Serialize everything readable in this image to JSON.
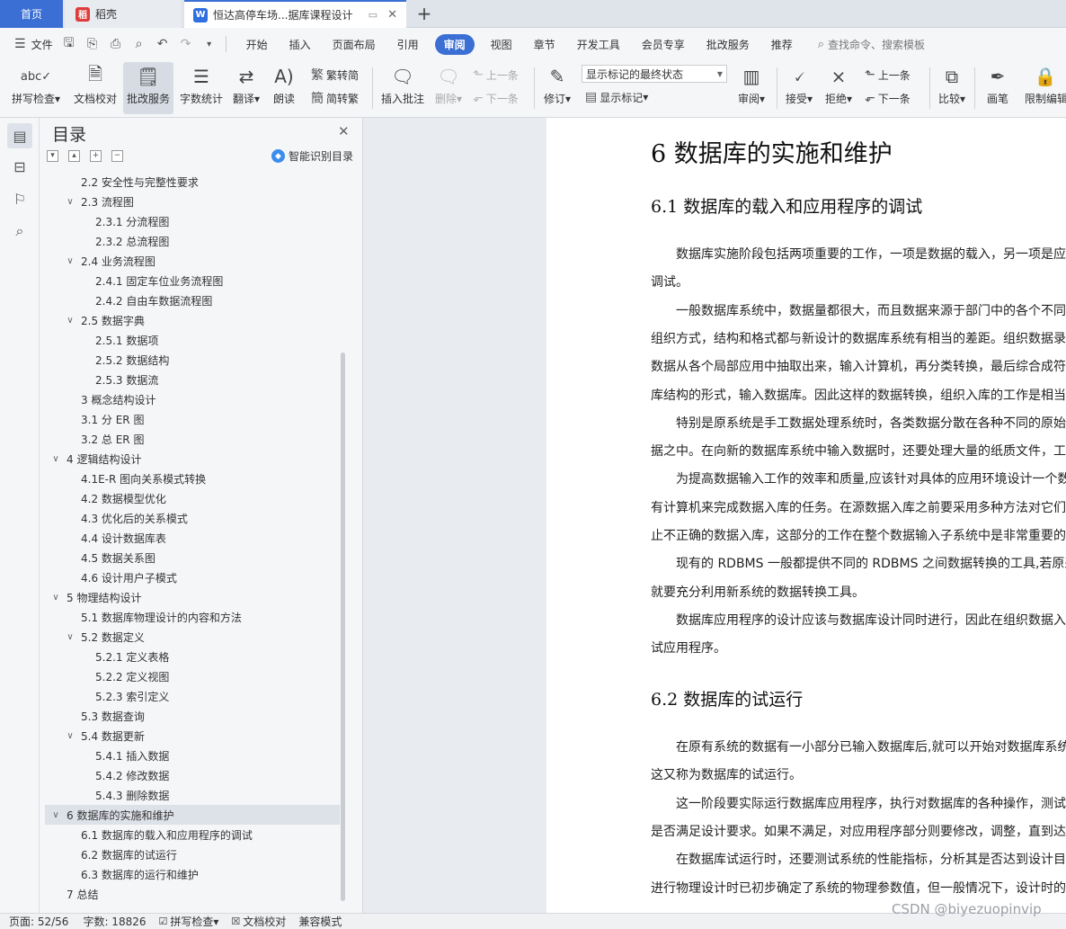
{
  "tabs": {
    "home": "首页",
    "daoke": "稻壳",
    "doc": "恒达高停车场...据库课程设计"
  },
  "menu": {
    "file": "文件",
    "items": [
      "开始",
      "插入",
      "页面布局",
      "引用",
      "审阅",
      "视图",
      "章节",
      "开发工具",
      "会员专享",
      "批改服务",
      "推荐"
    ],
    "active": "审阅",
    "search_placeholder": "查找命令、搜索模板"
  },
  "ribbon": {
    "spellcheck": "拼写检查",
    "doc_proof": "文档校对",
    "review_service": "批改服务",
    "word_count": "字数统计",
    "translate": "翻译",
    "read_aloud": "朗读",
    "trad_to_simp": "繁转简",
    "simp_to_trad": "简转繁",
    "insert_comment": "插入批注",
    "delete": "删除",
    "prev": "上一条",
    "next": "下一条",
    "track_changes": "修订",
    "markup_state": "显示标记的最终状态",
    "show_markup": "显示标记",
    "review": "审阅",
    "accept": "接受",
    "reject": "拒绝",
    "prev2": "上一条",
    "next2": "下一条",
    "compare": "比较",
    "pen": "画笔",
    "restrict": "限制编辑"
  },
  "nav": {
    "title": "目录",
    "smart_toc": "智能识别目录",
    "toc": [
      {
        "text": "2.2 安全性与完整性要求",
        "level": 2,
        "tog": ""
      },
      {
        "text": "2.3 流程图",
        "level": 2,
        "tog": "v"
      },
      {
        "text": "2.3.1 分流程图",
        "level": 3,
        "tog": ""
      },
      {
        "text": "2.3.2 总流程图",
        "level": 3,
        "tog": ""
      },
      {
        "text": "2.4 业务流程图",
        "level": 2,
        "tog": "v"
      },
      {
        "text": "2.4.1 固定车位业务流程图",
        "level": 3,
        "tog": ""
      },
      {
        "text": "2.4.2 自由车数据流程图",
        "level": 3,
        "tog": ""
      },
      {
        "text": "2.5 数据字典",
        "level": 2,
        "tog": "v"
      },
      {
        "text": "2.5.1 数据项",
        "level": 3,
        "tog": ""
      },
      {
        "text": "2.5.2 数据结构",
        "level": 3,
        "tog": ""
      },
      {
        "text": "2.5.3 数据流",
        "level": 3,
        "tog": ""
      },
      {
        "text": "3 概念结构设计",
        "level": 2,
        "tog": ""
      },
      {
        "text": "3.1 分 ER 图",
        "level": 2,
        "tog": ""
      },
      {
        "text": "3.2 总 ER 图",
        "level": 2,
        "tog": ""
      },
      {
        "text": "4 逻辑结构设计",
        "level": 1,
        "tog": "v"
      },
      {
        "text": "4.1E-R 图向关系模式转换",
        "level": 2,
        "tog": ""
      },
      {
        "text": "4.2 数据模型优化",
        "level": 2,
        "tog": ""
      },
      {
        "text": "4.3 优化后的关系模式",
        "level": 2,
        "tog": ""
      },
      {
        "text": "4.4 设计数据库表",
        "level": 2,
        "tog": ""
      },
      {
        "text": "4.5 数据关系图",
        "level": 2,
        "tog": ""
      },
      {
        "text": "4.6 设计用户子模式",
        "level": 2,
        "tog": ""
      },
      {
        "text": "5 物理结构设计",
        "level": 1,
        "tog": "v"
      },
      {
        "text": "5.1 数据库物理设计的内容和方法",
        "level": 2,
        "tog": ""
      },
      {
        "text": "5.2 数据定义",
        "level": 2,
        "tog": "v"
      },
      {
        "text": "5.2.1 定义表格",
        "level": 3,
        "tog": ""
      },
      {
        "text": "5.2.2 定义视图",
        "level": 3,
        "tog": ""
      },
      {
        "text": "5.2.3 索引定义",
        "level": 3,
        "tog": ""
      },
      {
        "text": "5.3 数据查询",
        "level": 2,
        "tog": ""
      },
      {
        "text": "5.4 数据更新",
        "level": 2,
        "tog": "v"
      },
      {
        "text": "5.4.1 插入数据",
        "level": 3,
        "tog": ""
      },
      {
        "text": "5.4.2 修改数据",
        "level": 3,
        "tog": ""
      },
      {
        "text": "5.4.3 删除数据",
        "level": 3,
        "tog": ""
      },
      {
        "text": "6 数据库的实施和维护",
        "level": 1,
        "tog": "v",
        "active": true
      },
      {
        "text": "6.1 数据库的载入和应用程序的调试",
        "level": 2,
        "tog": ""
      },
      {
        "text": "6.2 数据库的试运行",
        "level": 2,
        "tog": ""
      },
      {
        "text": "6.3 数据库的运行和维护",
        "level": 2,
        "tog": ""
      },
      {
        "text": "7 总结",
        "level": 1,
        "tog": ""
      }
    ]
  },
  "doc": {
    "h1": "6 数据库的实施和维护",
    "h2a": "6.1 数据库的载入和应用程序的调试",
    "h2b": "6.2 数据库的试运行",
    "lines_a": [
      {
        "t": "数据库实施阶段包括两项重要的工作，一项是数据的载入，另一项是应",
        "ind": true
      },
      {
        "t": "调试。",
        "ind": false
      },
      {
        "t": "一般数据库系统中，数据量都很大，而且数据来源于部门中的各个不同",
        "ind": true
      },
      {
        "t": "组织方式，结构和格式都与新设计的数据库系统有相当的差距。组织数据录",
        "ind": false
      },
      {
        "t": "数据从各个局部应用中抽取出来，输入计算机，再分类转换，最后综合成符",
        "ind": false
      },
      {
        "t": "库结构的形式，输入数据库。因此这样的数据转换，组织入库的工作是相当",
        "ind": false
      },
      {
        "t": "特别是原系统是手工数据处理系统时，各类数据分散在各种不同的原始",
        "ind": true
      },
      {
        "t": "据之中。在向新的数据库系统中输入数据时，还要处理大量的纸质文件，工",
        "ind": false
      },
      {
        "t": "为提高数据输入工作的效率和质量,应该针对具体的应用环境设计一个数",
        "ind": true
      },
      {
        "t": "有计算机来完成数据入库的任务。在源数据入库之前要采用多种方法对它们",
        "ind": false
      },
      {
        "t": "止不正确的数据入库，这部分的工作在整个数据输入子系统中是非常重要的",
        "ind": false
      },
      {
        "t": "现有的 RDBMS 一般都提供不同的 RDBMS 之间数据转换的工具,若原来",
        "ind": true
      },
      {
        "t": "就要充分利用新系统的数据转换工具。",
        "ind": false
      },
      {
        "t": "数据库应用程序的设计应该与数据库设计同时进行，因此在组织数据入",
        "ind": true
      },
      {
        "t": "试应用程序。",
        "ind": false
      }
    ],
    "lines_b": [
      {
        "t": "在原有系统的数据有一小部分已输入数据库后,就可以开始对数据库系统",
        "ind": true
      },
      {
        "t": "这又称为数据库的试运行。",
        "ind": false
      },
      {
        "t": "这一阶段要实际运行数据库应用程序，执行对数据库的各种操作，测试",
        "ind": true
      },
      {
        "t": "是否满足设计要求。如果不满足，对应用程序部分则要修改，调整，直到达",
        "ind": false
      },
      {
        "t": "在数据库试运行时，还要测试系统的性能指标，分析其是否达到设计目",
        "ind": true
      },
      {
        "t": "进行物理设计时已初步确定了系统的物理参数值，但一般情况下，设计时的",
        "ind": false
      }
    ]
  },
  "status": {
    "page": "页面: 52/56",
    "words": "字数: 18826",
    "spellcheck": "拼写检查",
    "doc_proof": "文档校对",
    "compat": "兼容模式"
  },
  "watermark": "CSDN @biyezuopinvip",
  "colors": {
    "accent": "#3b6fd4",
    "tab_bar": "#dfe3ea",
    "panel": "#f5f6f8"
  }
}
